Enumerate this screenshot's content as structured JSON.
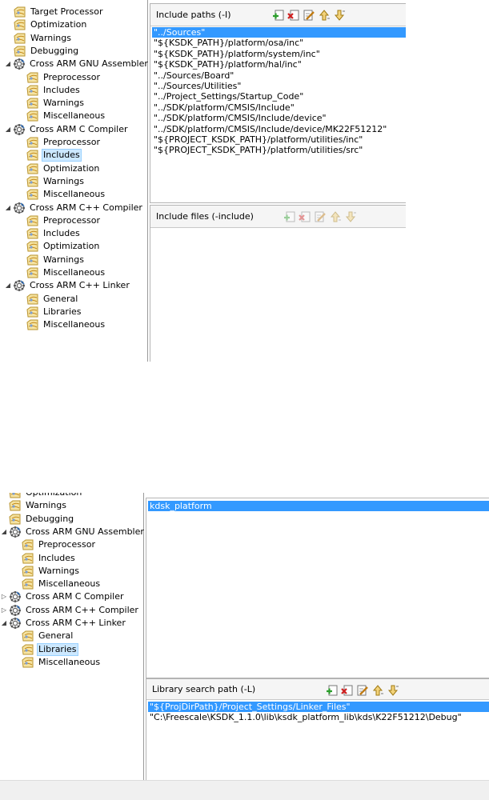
{
  "window_title": "",
  "colors": {
    "selection_bg": "#3399ff",
    "tree_selection_bg": "#cce8ff",
    "header_bg": "#f5f5f5"
  },
  "top_view": {
    "tree": [
      {
        "label": "Target Processor",
        "level": 1,
        "icon": "settings-page-icon"
      },
      {
        "label": "Optimization",
        "level": 1,
        "icon": "settings-page-icon"
      },
      {
        "label": "Warnings",
        "level": 1,
        "icon": "settings-page-icon"
      },
      {
        "label": "Debugging",
        "level": 1,
        "icon": "settings-page-icon"
      },
      {
        "label": "Cross ARM GNU Assembler",
        "level": 0,
        "icon": "tool-gear-icon",
        "expander": "expanded"
      },
      {
        "label": "Preprocessor",
        "level": 2,
        "icon": "settings-page-icon"
      },
      {
        "label": "Includes",
        "level": 2,
        "icon": "settings-page-icon"
      },
      {
        "label": "Warnings",
        "level": 2,
        "icon": "settings-page-icon"
      },
      {
        "label": "Miscellaneous",
        "level": 2,
        "icon": "settings-page-icon"
      },
      {
        "label": "Cross ARM C Compiler",
        "level": 0,
        "icon": "tool-gear-icon",
        "expander": "expanded"
      },
      {
        "label": "Preprocessor",
        "level": 2,
        "icon": "settings-page-icon"
      },
      {
        "label": "Includes",
        "level": 2,
        "icon": "settings-page-icon",
        "selected": true
      },
      {
        "label": "Optimization",
        "level": 2,
        "icon": "settings-page-icon"
      },
      {
        "label": "Warnings",
        "level": 2,
        "icon": "settings-page-icon"
      },
      {
        "label": "Miscellaneous",
        "level": 2,
        "icon": "settings-page-icon"
      },
      {
        "label": "Cross ARM C++ Compiler",
        "level": 0,
        "icon": "tool-gear-icon",
        "expander": "expanded"
      },
      {
        "label": "Preprocessor",
        "level": 2,
        "icon": "settings-page-icon"
      },
      {
        "label": "Includes",
        "level": 2,
        "icon": "settings-page-icon"
      },
      {
        "label": "Optimization",
        "level": 2,
        "icon": "settings-page-icon"
      },
      {
        "label": "Warnings",
        "level": 2,
        "icon": "settings-page-icon"
      },
      {
        "label": "Miscellaneous",
        "level": 2,
        "icon": "settings-page-icon"
      },
      {
        "label": "Cross ARM C++ Linker",
        "level": 0,
        "icon": "tool-gear-icon",
        "expander": "expanded"
      },
      {
        "label": "General",
        "level": 2,
        "icon": "settings-page-icon"
      },
      {
        "label": "Libraries",
        "level": 2,
        "icon": "settings-page-icon"
      },
      {
        "label": "Miscellaneous",
        "level": 2,
        "icon": "settings-page-icon"
      }
    ],
    "include_paths": {
      "title": "Include paths (-I)",
      "tools": [
        "add-icon",
        "delete-icon",
        "edit-icon",
        "move-up-icon",
        "move-down-icon"
      ],
      "tools_enabled": true,
      "items": [
        {
          "text": "\"../Sources\"",
          "selected": true
        },
        {
          "text": "\"${KSDK_PATH}/platform/osa/inc\""
        },
        {
          "text": "\"${KSDK_PATH}/platform/system/inc\""
        },
        {
          "text": "\"${KSDK_PATH}/platform/hal/inc\""
        },
        {
          "text": "\"../Sources/Board\""
        },
        {
          "text": "\"../Sources/Utilities\""
        },
        {
          "text": "\"../Project_Settings/Startup_Code\""
        },
        {
          "text": "\"../SDK/platform/CMSIS/Include\""
        },
        {
          "text": "\"../SDK/platform/CMSIS/Include/device\""
        },
        {
          "text": "\"../SDK/platform/CMSIS/Include/device/MK22F51212\""
        },
        {
          "text": "\"${PROJECT_KSDK_PATH}/platform/utilities/inc\""
        },
        {
          "text": "\"${PROJECT_KSDK_PATH}/platform/utilities/src\""
        }
      ]
    },
    "include_files": {
      "title": "Include files (-include)",
      "tools": [
        "add-icon",
        "delete-icon",
        "edit-icon",
        "move-up-icon",
        "move-down-icon"
      ],
      "tools_enabled": false,
      "items": []
    }
  },
  "bottom_view": {
    "tree": [
      {
        "label": "Optimization",
        "level": 1,
        "icon": "settings-page-icon",
        "partial": true
      },
      {
        "label": "Warnings",
        "level": 1,
        "icon": "settings-page-icon"
      },
      {
        "label": "Debugging",
        "level": 1,
        "icon": "settings-page-icon"
      },
      {
        "label": "Cross ARM GNU Assembler",
        "level": 0,
        "icon": "tool-gear-icon",
        "expander": "expanded"
      },
      {
        "label": "Preprocessor",
        "level": 2,
        "icon": "settings-page-icon"
      },
      {
        "label": "Includes",
        "level": 2,
        "icon": "settings-page-icon"
      },
      {
        "label": "Warnings",
        "level": 2,
        "icon": "settings-page-icon"
      },
      {
        "label": "Miscellaneous",
        "level": 2,
        "icon": "settings-page-icon"
      },
      {
        "label": "Cross ARM C Compiler",
        "level": 0,
        "icon": "tool-gear-icon",
        "expander": "collapsed"
      },
      {
        "label": "Cross ARM C++ Compiler",
        "level": 0,
        "icon": "tool-gear-icon",
        "expander": "collapsed"
      },
      {
        "label": "Cross ARM C++ Linker",
        "level": 0,
        "icon": "tool-gear-icon",
        "expander": "expanded"
      },
      {
        "label": "General",
        "level": 2,
        "icon": "settings-page-icon"
      },
      {
        "label": "Libraries",
        "level": 2,
        "icon": "settings-page-icon",
        "selected": true
      },
      {
        "label": "Miscellaneous",
        "level": 2,
        "icon": "settings-page-icon"
      }
    ],
    "libraries": {
      "title": "",
      "items": [
        {
          "text": "kdsk_platform",
          "selected": true
        }
      ]
    },
    "library_search_path": {
      "title": "Library search path (-L)",
      "tools": [
        "add-icon",
        "delete-icon",
        "edit-icon",
        "move-up-icon",
        "move-down-icon"
      ],
      "tools_enabled": true,
      "items": [
        {
          "text": "\"${ProjDirPath}/Project_Settings/Linker_Files\"",
          "selected": true
        },
        {
          "text": "\"C:\\Freescale\\KSDK_1.1.0\\lib\\ksdk_platform_lib\\kds\\K22F51212\\Debug\""
        }
      ]
    }
  }
}
